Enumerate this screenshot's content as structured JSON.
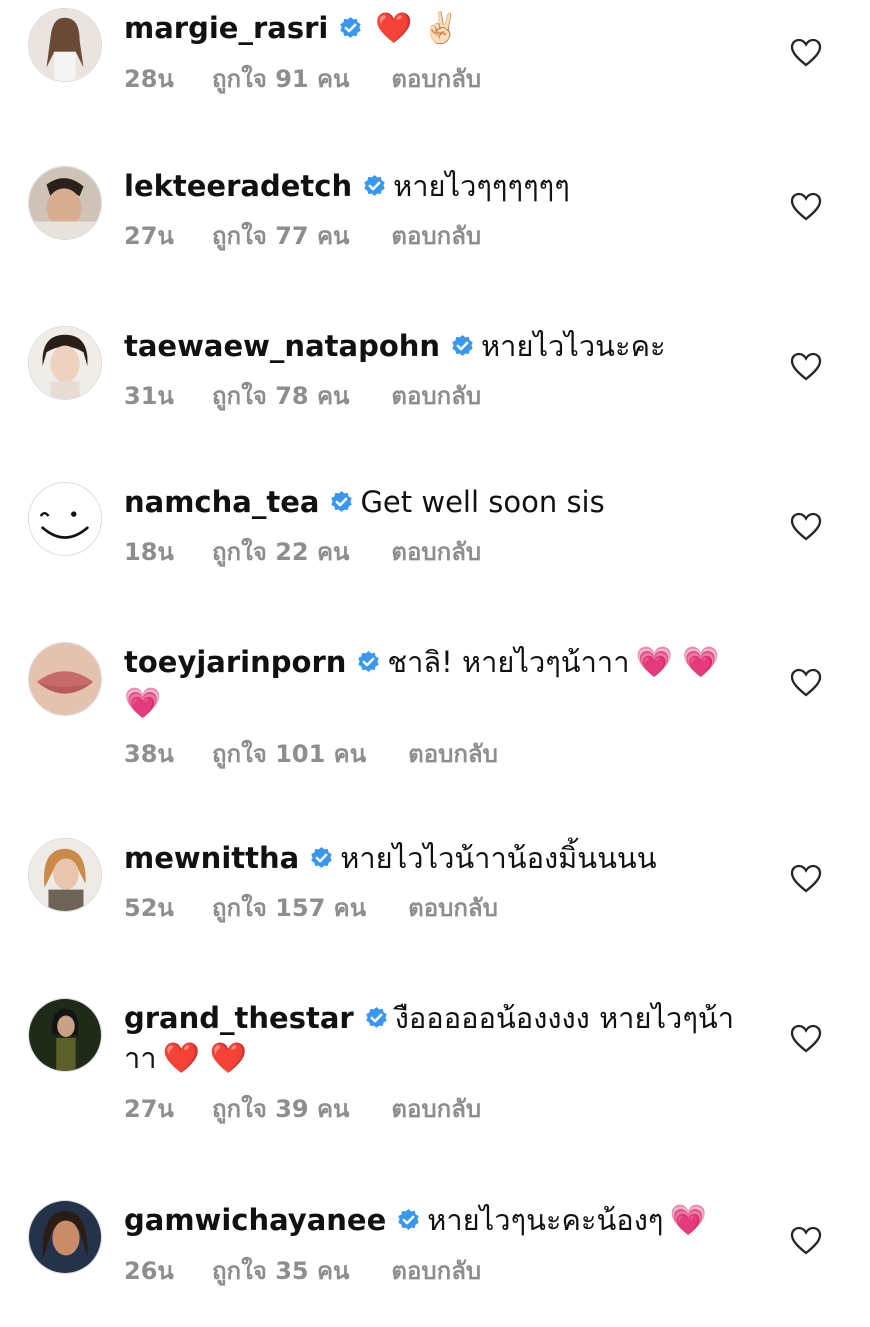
{
  "verified_color": "#3897f0",
  "meta_color": "#8e8e8e",
  "comments": [
    {
      "user": "margie_rasri",
      "text": "",
      "emoji": "❤️ ✌🏻",
      "time": "28น",
      "likes": "ถูกใจ 91 คน",
      "reply": "ตอบกลับ",
      "avatar": "avatar-icon"
    },
    {
      "user": "lekteeradetch",
      "text": "หายไวๆๆๆๆๆๆ",
      "emoji": "",
      "time": "27น",
      "likes": "ถูกใจ 77 คน",
      "reply": "ตอบกลับ",
      "avatar": "avatar-icon"
    },
    {
      "user": "taewaew_natapohn",
      "text": "หายไวไวนะคะ",
      "emoji": "",
      "time": "31น",
      "likes": "ถูกใจ 78 คน",
      "reply": "ตอบกลับ",
      "avatar": "avatar-icon"
    },
    {
      "user": "namcha_tea",
      "text": "Get well soon sis",
      "emoji": "",
      "time": "18น",
      "likes": "ถูกใจ 22 คน",
      "reply": "ตอบกลับ",
      "avatar": "smiley-avatar-icon"
    },
    {
      "user": "toeyjarinporn",
      "text": "ชาลิ! หายไวๆน้าาา",
      "emoji": "💗 💗",
      "emoji2": "💗",
      "time": "38น",
      "likes": "ถูกใจ 101 คน",
      "reply": "ตอบกลับ",
      "avatar": "avatar-icon"
    },
    {
      "user": "mewnittha",
      "text": "หายไวไวน้าาน้องมิ้นนนน",
      "emoji": "",
      "time": "52น",
      "likes": "ถูกใจ 157 คน",
      "reply": "ตอบกลับ",
      "avatar": "avatar-icon"
    },
    {
      "user": "grand_thestar",
      "text": "งือออออน้องงงง หายไวๆน้า",
      "text2": "าา",
      "emoji": "",
      "emoji2": "❤️ ❤️",
      "time": "27น",
      "likes": "ถูกใจ 39 คน",
      "reply": "ตอบกลับ",
      "avatar": "avatar-icon"
    },
    {
      "user": "gamwichayanee",
      "text": "หายไวๆนะคะน้องๆ",
      "emoji": "💗",
      "time": "26น",
      "likes": "ถูกใจ 35 คน",
      "reply": "ตอบกลับ",
      "avatar": "avatar-icon"
    }
  ]
}
